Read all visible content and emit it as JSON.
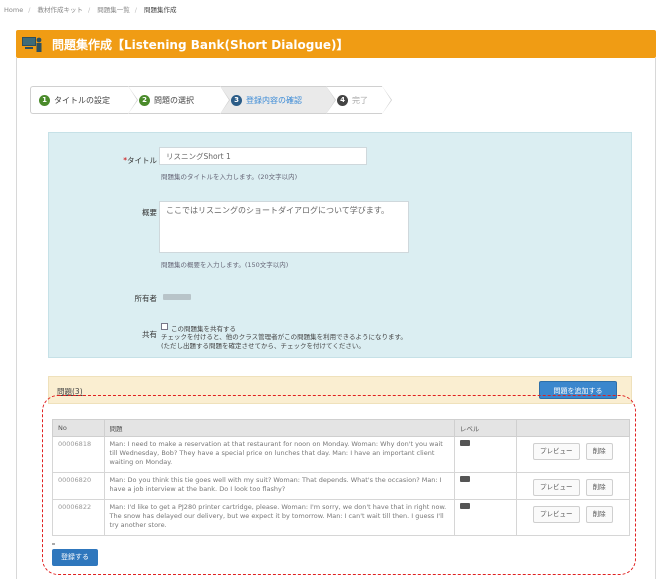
{
  "breadcrumb": [
    "Home",
    "教材作成キット",
    "問題集一覧",
    "問題集作成"
  ],
  "header": {
    "title": "問題集作成【Listening Bank(Short Dialogue)】",
    "color": "#f09c14"
  },
  "steps": [
    {
      "num": "1",
      "label": "タイトルの設定"
    },
    {
      "num": "2",
      "label": "問題の選択"
    },
    {
      "num": "3",
      "label": "登録内容の確認"
    },
    {
      "num": "4",
      "label": "完了"
    }
  ],
  "form": {
    "title_label": "タイトル",
    "title_value": "リスニングShort 1",
    "title_help": "問題集のタイトルを入力します。(20文字以内)",
    "summary_label": "概要",
    "summary_value": "ここではリスニングのショートダイアログについて学びます。",
    "summary_help": "問題集の概要を入力します。(150文字以内)",
    "owner_label": "所有者",
    "share_label": "共有",
    "share_checkbox_label": "この問題集を共有する",
    "share_note_1": "チェックを付けると、他のクラス管理者がこの問題集を利用できるようになります。",
    "share_note_2": "(ただし出題する問題を確定させてから、チェックを付けてください。"
  },
  "questions": {
    "title": "問題(3)",
    "add_button": "問題を追加する",
    "columns": [
      "No",
      "問題",
      "レベル",
      ""
    ],
    "rows": [
      {
        "no": "00006818",
        "text": "Man: I need to make a reservation at that restaurant for noon on Monday. Woman: Why don't you wait till Wednesday, Bob? They have a special price on lunches that day. Man: I have an important client waiting on Monday."
      },
      {
        "no": "00006820",
        "text": "Man: Do you think this tie goes well with my suit? Woman: That depends. What's the occasion? Man: I have a job interview at the bank. Do I look too flashy?"
      },
      {
        "no": "00006822",
        "text": "Man: I'd like to get a PJ280 printer cartridge, please. Woman: I'm sorry, we don't have that in right now. The snow has delayed our delivery, but we expect it by tomorrow. Man: I can't wait till then. I guess I'll try another store."
      }
    ],
    "preview_label": "プレビュー",
    "delete_label": "削除"
  },
  "submit_label": "登録する",
  "highlight_color": "#e02020"
}
